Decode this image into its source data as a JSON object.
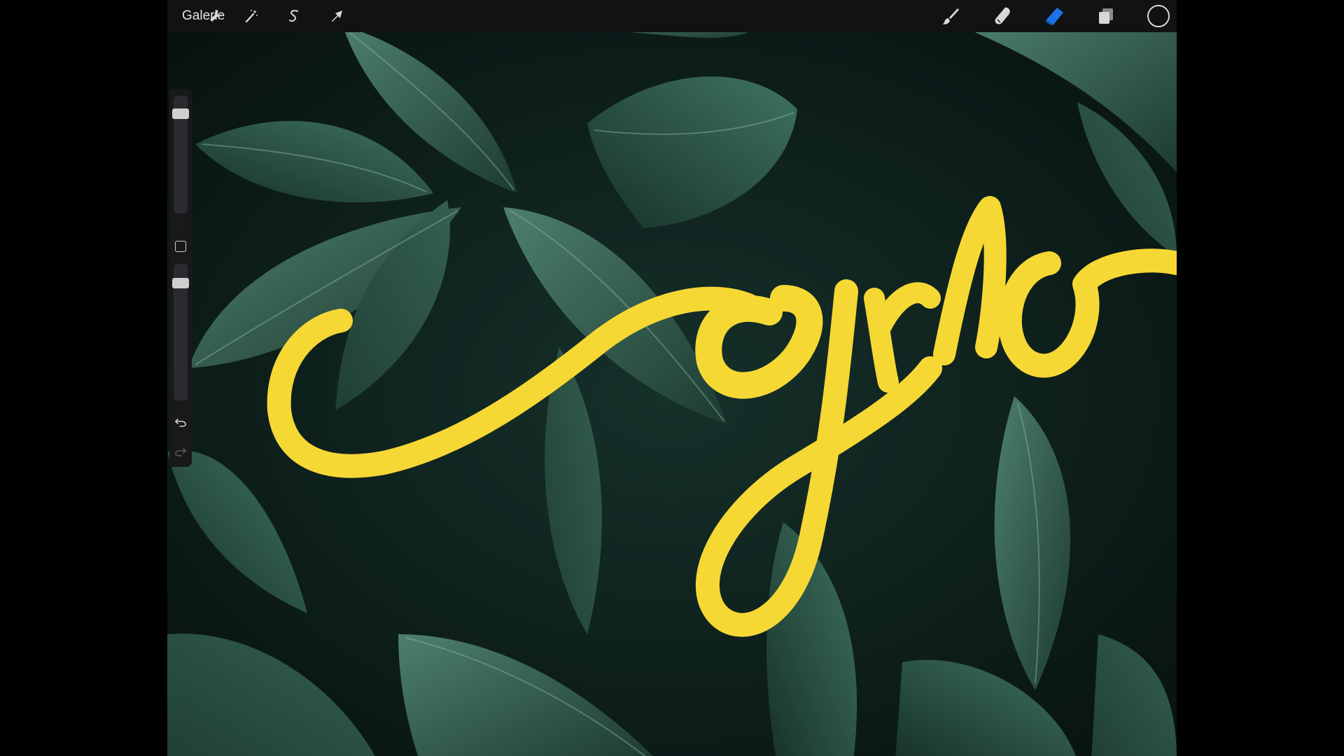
{
  "topbar": {
    "gallery_label": "Galerie",
    "left_tools": [
      {
        "name": "actions",
        "icon": "wrench-icon"
      },
      {
        "name": "adjustments",
        "icon": "magic-wand-icon"
      },
      {
        "name": "selection",
        "icon": "selection-s-icon"
      },
      {
        "name": "transform",
        "icon": "arrow-cursor-icon"
      }
    ],
    "right_tools": [
      {
        "name": "paint",
        "icon": "brush-icon"
      },
      {
        "name": "smudge",
        "icon": "smudge-finger-icon"
      },
      {
        "name": "erase",
        "icon": "eraser-icon",
        "active": true
      },
      {
        "name": "layers",
        "icon": "layers-icon"
      },
      {
        "name": "color",
        "icon": "color-swatch-icon"
      }
    ]
  },
  "sidebar": {
    "brush_size_level": 0.9,
    "opacity_level": 0.9,
    "controls": [
      "brush-size-slider",
      "modify-button",
      "opacity-slider",
      "undo-button",
      "redo-button"
    ]
  },
  "colors": {
    "active_tool": "#1a73e8",
    "current_color": "#111111",
    "lettering": "#f6d835",
    "leaf_dark": "#1d3b31",
    "leaf_mid": "#2e5b4b",
    "leaf_light": "#4d7f6c",
    "background": "#0b1714"
  }
}
